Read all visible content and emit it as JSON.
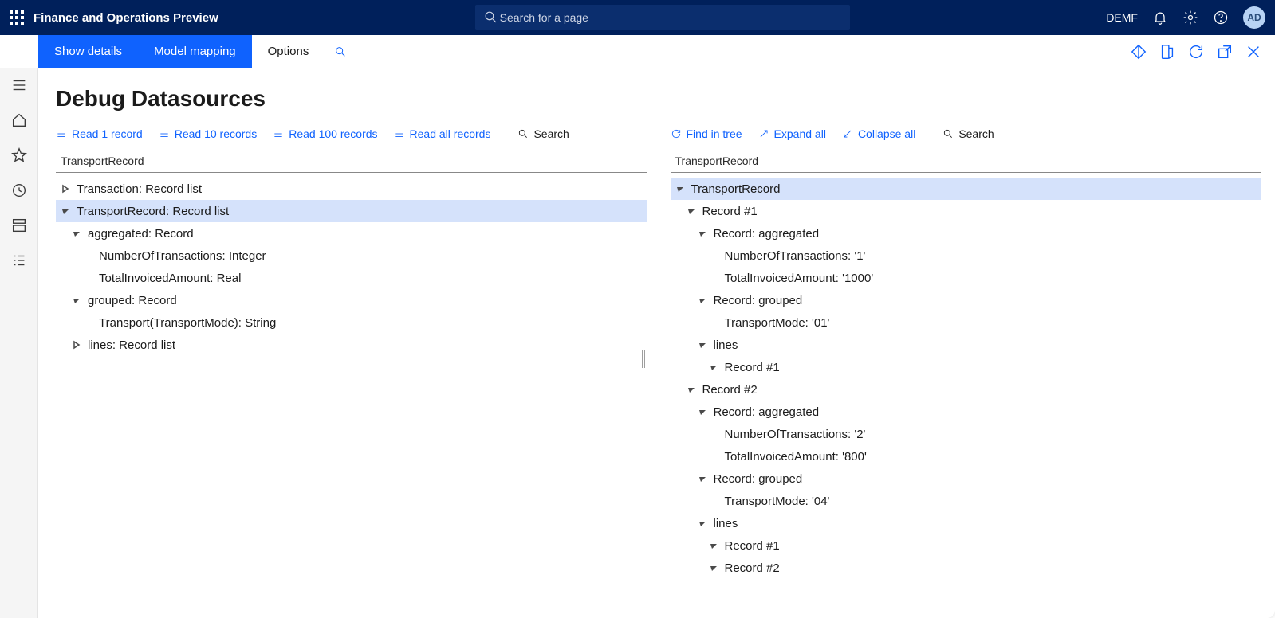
{
  "topbar": {
    "app_title": "Finance and Operations Preview",
    "search_placeholder": "Search for a page",
    "company": "DEMF",
    "avatar": "AD"
  },
  "actionbar": {
    "show_details": "Show details",
    "model_mapping": "Model mapping",
    "options": "Options"
  },
  "page": {
    "title": "Debug Datasources"
  },
  "left": {
    "cmds": {
      "read1": "Read 1 record",
      "read10": "Read 10 records",
      "read100": "Read 100 records",
      "readall": "Read all records",
      "search": "Search"
    },
    "header": "TransportRecord",
    "tree": [
      {
        "indent": 0,
        "caret": "closed",
        "text": "Transaction: Record list",
        "selected": false
      },
      {
        "indent": 0,
        "caret": "open",
        "text": "TransportRecord: Record list",
        "selected": true
      },
      {
        "indent": 1,
        "caret": "open",
        "text": "aggregated: Record"
      },
      {
        "indent": 2,
        "caret": "none",
        "text": "NumberOfTransactions: Integer"
      },
      {
        "indent": 2,
        "caret": "none",
        "text": "TotalInvoicedAmount: Real"
      },
      {
        "indent": 1,
        "caret": "open",
        "text": "grouped: Record"
      },
      {
        "indent": 2,
        "caret": "none",
        "text": "Transport(TransportMode): String"
      },
      {
        "indent": 1,
        "caret": "closed",
        "text": "lines: Record list"
      }
    ]
  },
  "right": {
    "cmds": {
      "find": "Find in tree",
      "expand": "Expand all",
      "collapse": "Collapse all",
      "search": "Search"
    },
    "header": "TransportRecord",
    "tree": [
      {
        "indent": 0,
        "caret": "open",
        "text": "TransportRecord",
        "selected": true
      },
      {
        "indent": 1,
        "caret": "open",
        "text": "Record #1"
      },
      {
        "indent": 2,
        "caret": "open",
        "text": "Record: aggregated"
      },
      {
        "indent": 3,
        "caret": "none",
        "text": "NumberOfTransactions: '1'"
      },
      {
        "indent": 3,
        "caret": "none",
        "text": "TotalInvoicedAmount: '1000'"
      },
      {
        "indent": 2,
        "caret": "open",
        "text": "Record: grouped"
      },
      {
        "indent": 3,
        "caret": "none",
        "text": "TransportMode: '01'"
      },
      {
        "indent": 2,
        "caret": "open",
        "text": "lines"
      },
      {
        "indent": 3,
        "caret": "open",
        "text": "Record #1"
      },
      {
        "indent": 1,
        "caret": "open",
        "text": "Record #2"
      },
      {
        "indent": 2,
        "caret": "open",
        "text": "Record: aggregated"
      },
      {
        "indent": 3,
        "caret": "none",
        "text": "NumberOfTransactions: '2'"
      },
      {
        "indent": 3,
        "caret": "none",
        "text": "TotalInvoicedAmount: '800'"
      },
      {
        "indent": 2,
        "caret": "open",
        "text": "Record: grouped"
      },
      {
        "indent": 3,
        "caret": "none",
        "text": "TransportMode: '04'"
      },
      {
        "indent": 2,
        "caret": "open",
        "text": "lines"
      },
      {
        "indent": 3,
        "caret": "open",
        "text": "Record #1"
      },
      {
        "indent": 3,
        "caret": "open",
        "text": "Record #2"
      }
    ]
  }
}
